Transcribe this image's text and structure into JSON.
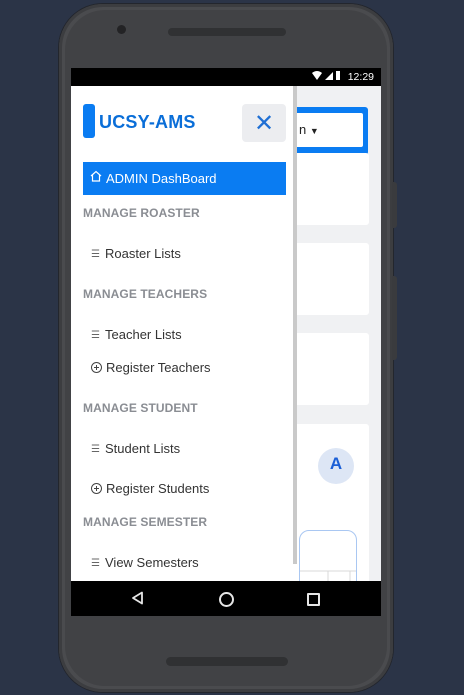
{
  "status_bar": {
    "time": "12:29",
    "icons": [
      "wifi-icon",
      "signal-icon",
      "battery-icon"
    ]
  },
  "background_page": {
    "dropdown_text": "n",
    "logo_text": "A"
  },
  "sidebar": {
    "brand": "UCSY-AMS",
    "active_item": {
      "label": "ADMIN DashBoard",
      "icon": "home-icon"
    },
    "sections": [
      {
        "title": "MANAGE ROASTER",
        "items": [
          {
            "label": "Roaster Lists",
            "icon": "list-icon"
          }
        ]
      },
      {
        "title": "MANAGE TEACHERS",
        "items": [
          {
            "label": "Teacher Lists",
            "icon": "list-icon"
          },
          {
            "label": "Register Teachers",
            "icon": "plus-circle-icon"
          }
        ]
      },
      {
        "title": "MANAGE STUDENT",
        "items": [
          {
            "label": "Student Lists",
            "icon": "list-icon"
          },
          {
            "label": "Register Students",
            "icon": "plus-circle-icon"
          }
        ]
      },
      {
        "title": "MANAGE SEMESTER",
        "items": [
          {
            "label": "View Semesters",
            "icon": "list-icon"
          }
        ]
      }
    ]
  },
  "colors": {
    "accent": "#0a7cf2",
    "brand_text": "#0a6ed8",
    "section_text": "#8a8d93",
    "background": "#2b3447"
  }
}
